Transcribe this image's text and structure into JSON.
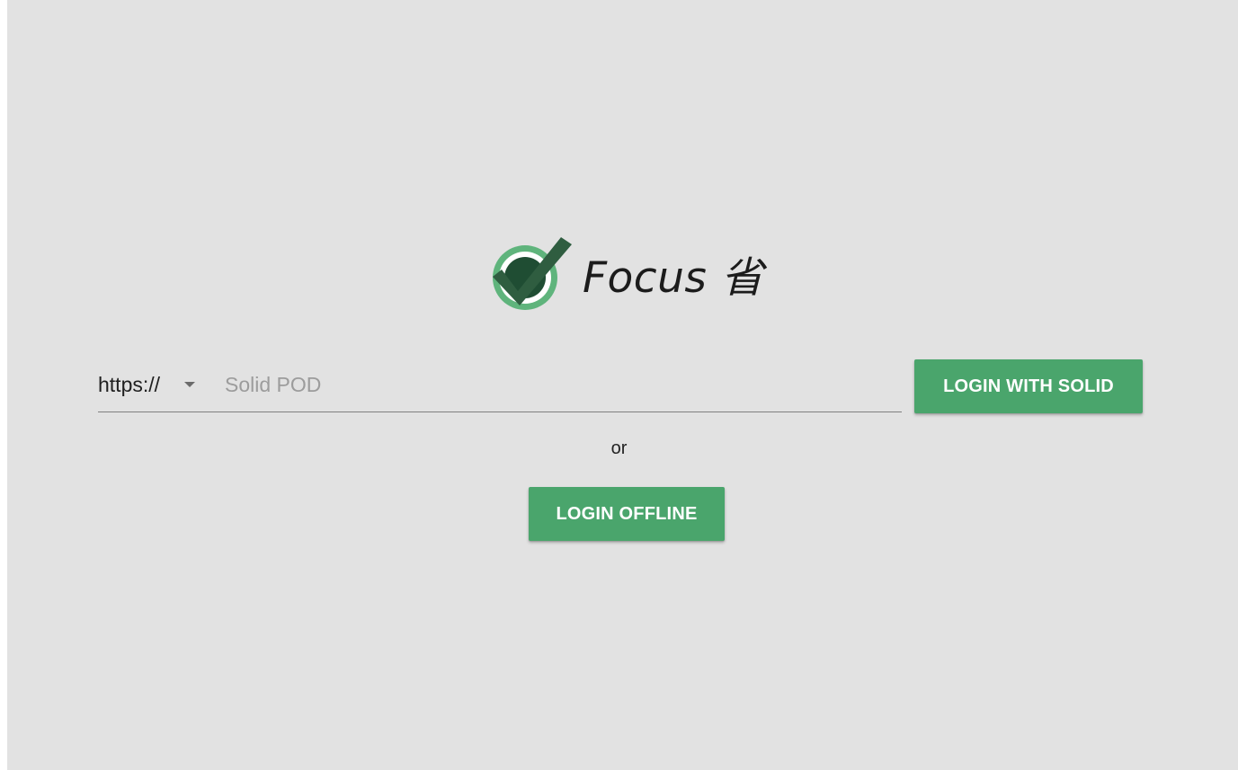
{
  "app": {
    "title": "Focus 省"
  },
  "login": {
    "protocol": {
      "selected": "https://"
    },
    "pod_input": {
      "value": "",
      "placeholder": "Solid POD"
    },
    "solid_button_label": "LOGIN WITH SOLID",
    "separator": "or",
    "offline_button_label": "LOGIN OFFLINE"
  },
  "colors": {
    "background": "#e2e2e2",
    "primary": "#4aa56c",
    "logo_check": "#2f5d40",
    "logo_ring": "#5fb47c"
  },
  "icons": {
    "logo": "check-circle-logo-icon",
    "dropdown": "caret-down-icon"
  }
}
